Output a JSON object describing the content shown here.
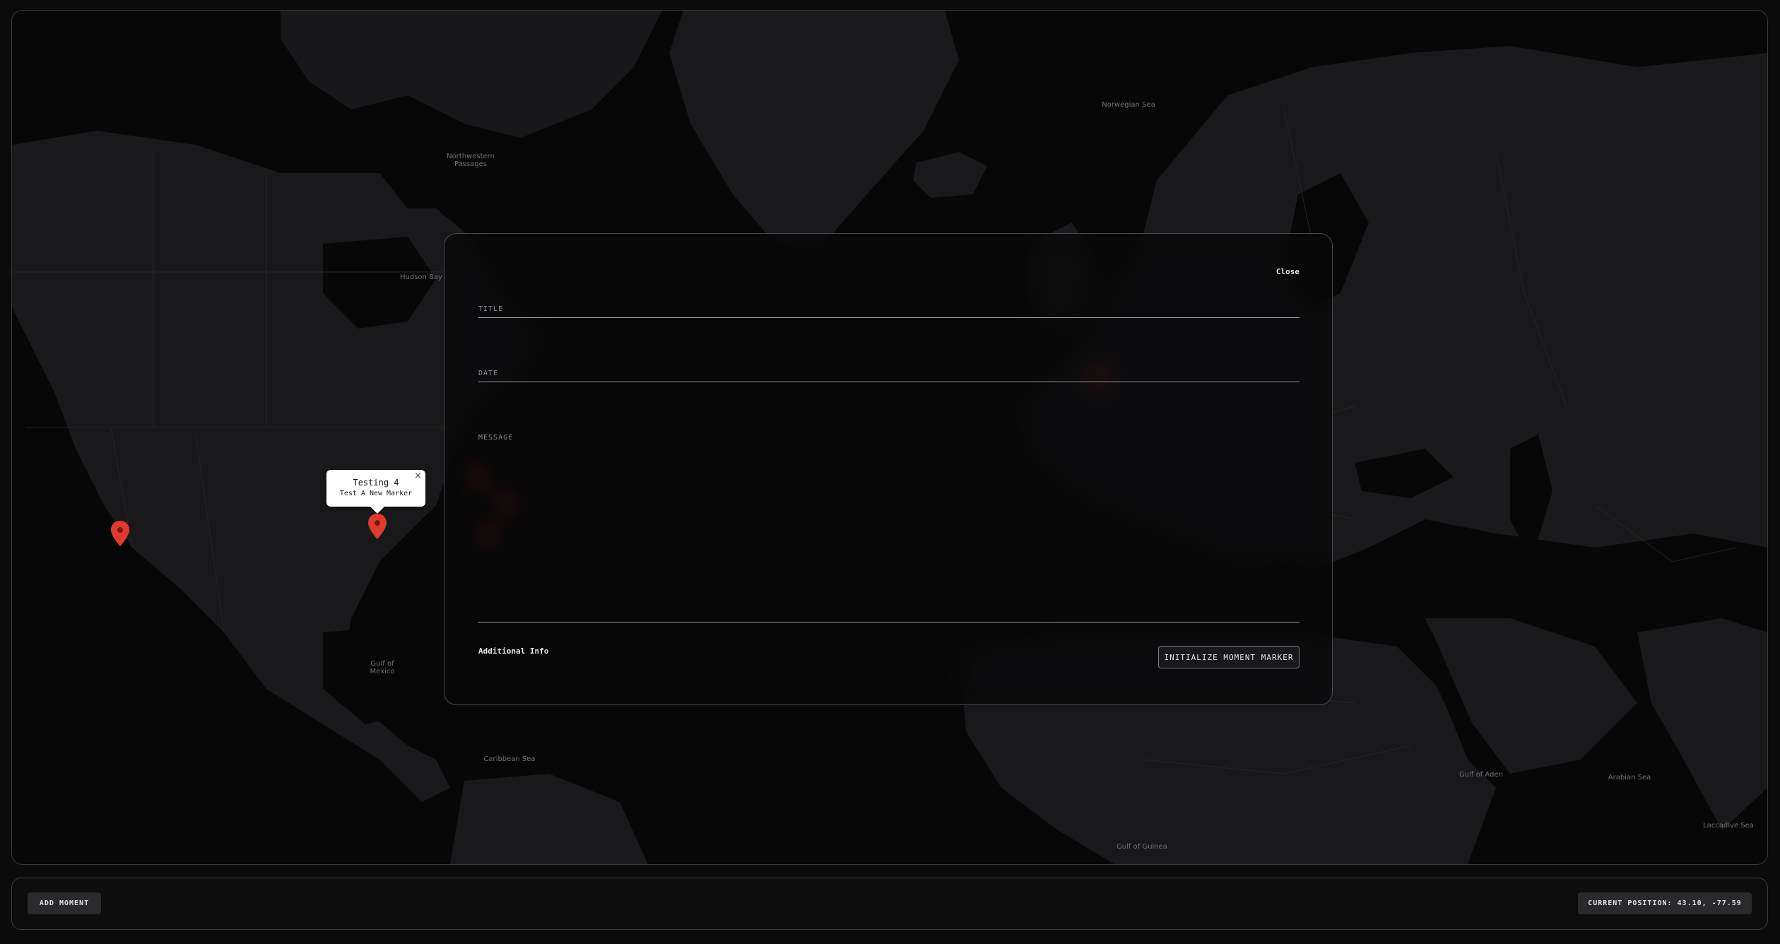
{
  "map": {
    "labels": [
      {
        "id": "norwegian-sea",
        "text": "Norwegian Sea"
      },
      {
        "id": "northwestern-passages",
        "text": "Northwestern\nPassages"
      },
      {
        "id": "hudson-bay",
        "text": "Hudson Bay"
      },
      {
        "id": "gulf-of-mexico",
        "text": "Gulf of\nMexico"
      },
      {
        "id": "caribbean-sea",
        "text": "Caribbean Sea"
      },
      {
        "id": "gulf-of-guinea",
        "text": "Gulf of Guinea"
      },
      {
        "id": "gulf-of-aden",
        "text": "Gulf of Aden"
      },
      {
        "id": "arabian-sea",
        "text": "Arabian Sea"
      },
      {
        "id": "laccadive-sea",
        "text": "Laccadive Sea"
      }
    ],
    "marker_color": "#e0392e"
  },
  "popup": {
    "title": "Testing 4",
    "subtitle": "Test A New Marker",
    "close_icon": "×"
  },
  "modal": {
    "close_label": "Close",
    "title_placeholder": "TITLE",
    "date_placeholder": "DATE",
    "message_placeholder": "MESSAGE",
    "additional_info_label": "Additional Info",
    "submit_label": "INITIALIZE MOMENT MARKER"
  },
  "footer": {
    "add_moment_label": "ADD MOMENT",
    "position_label": "CURRENT POSITION: 43.10, -77.59"
  }
}
